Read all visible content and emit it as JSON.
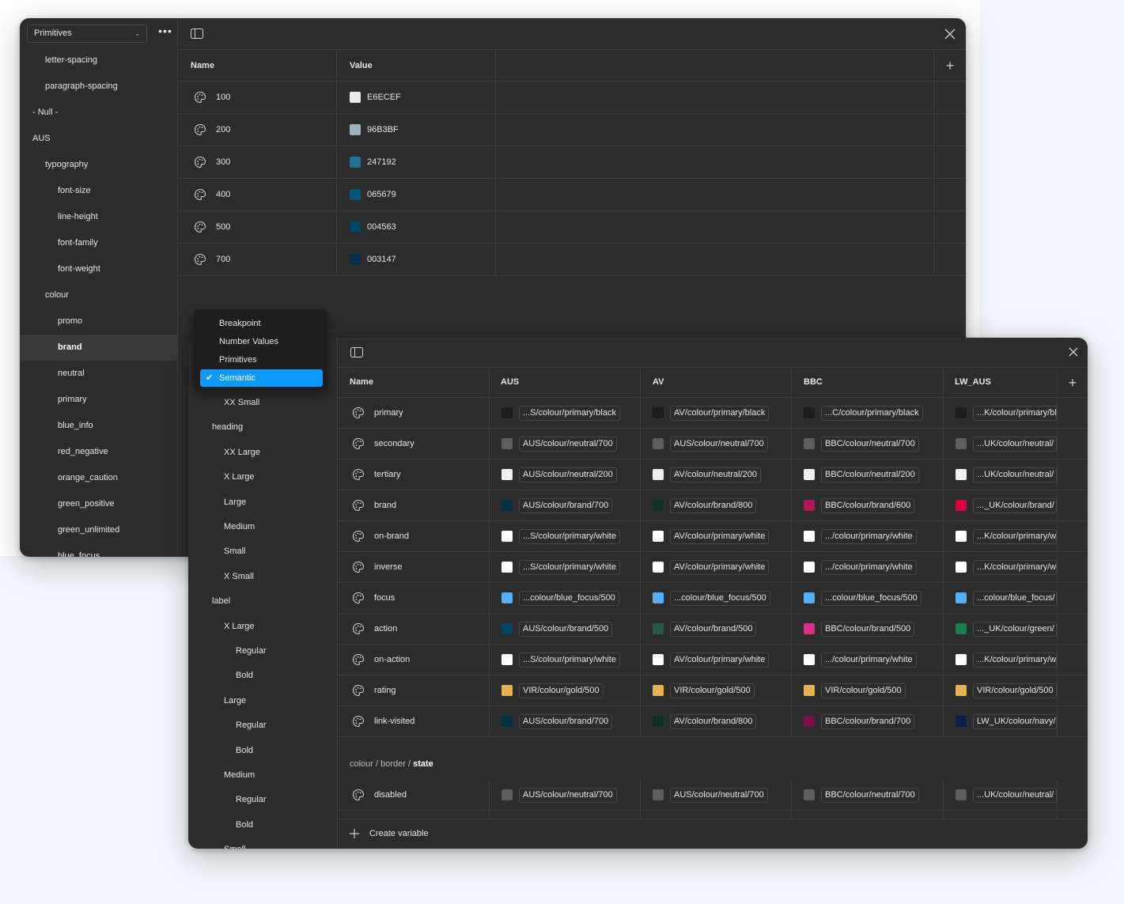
{
  "back_panel": {
    "collection_select": "Primitives",
    "sidebar": [
      {
        "label": "letter-spacing",
        "level": 1
      },
      {
        "label": "paragraph-spacing",
        "level": 1
      },
      {
        "label": "- Null -",
        "level": 0
      },
      {
        "label": "AUS",
        "level": 0
      },
      {
        "label": "typography",
        "level": 1
      },
      {
        "label": "font-size",
        "level": 2
      },
      {
        "label": "line-height",
        "level": 2
      },
      {
        "label": "font-family",
        "level": 2
      },
      {
        "label": "font-weight",
        "level": 2
      },
      {
        "label": "colour",
        "level": 1
      },
      {
        "label": "promo",
        "level": 2
      },
      {
        "label": "brand",
        "level": 2,
        "selected": true
      },
      {
        "label": "neutral",
        "level": 2
      },
      {
        "label": "primary",
        "level": 2
      },
      {
        "label": "blue_info",
        "level": 2
      },
      {
        "label": "red_negative",
        "level": 2
      },
      {
        "label": "orange_caution",
        "level": 2
      },
      {
        "label": "green_positive",
        "level": 2
      },
      {
        "label": "green_unlimited",
        "level": 2
      },
      {
        "label": "blue_focus",
        "level": 2
      }
    ],
    "columns": {
      "name": "Name",
      "value": "Value"
    },
    "rows": [
      {
        "name": "100",
        "value": "E6ECEF",
        "color": "#E6ECEF"
      },
      {
        "name": "200",
        "value": "96B3BF",
        "color": "#96B3BF"
      },
      {
        "name": "300",
        "value": "247192",
        "color": "#247192"
      },
      {
        "name": "400",
        "value": "065679",
        "color": "#065679"
      },
      {
        "name": "500",
        "value": "004563",
        "color": "#004563"
      },
      {
        "name": "700",
        "value": "003147",
        "color": "#003147"
      }
    ]
  },
  "dropdown": {
    "items": [
      {
        "label": "Breakpoint",
        "selected": false
      },
      {
        "label": "Number Values",
        "selected": false
      },
      {
        "label": "Primitives",
        "selected": false
      },
      {
        "label": "Semantic",
        "selected": true
      }
    ]
  },
  "front_panel": {
    "sidebar": [
      {
        "label": "XX Small",
        "level": 2
      },
      {
        "label": "heading",
        "level": 1
      },
      {
        "label": "XX Large",
        "level": 2
      },
      {
        "label": "X Large",
        "level": 2
      },
      {
        "label": "Large",
        "level": 2
      },
      {
        "label": "Medium",
        "level": 2
      },
      {
        "label": "Small",
        "level": 2
      },
      {
        "label": "X Small",
        "level": 2
      },
      {
        "label": "label",
        "level": 1
      },
      {
        "label": "X Large",
        "level": 2
      },
      {
        "label": "Regular",
        "level": 3
      },
      {
        "label": "Bold",
        "level": 3
      },
      {
        "label": "Large",
        "level": 2
      },
      {
        "label": "Regular",
        "level": 3
      },
      {
        "label": "Bold",
        "level": 3
      },
      {
        "label": "Medium",
        "level": 2
      },
      {
        "label": "Regular",
        "level": 3
      },
      {
        "label": "Bold",
        "level": 3
      },
      {
        "label": "Small",
        "level": 2
      }
    ],
    "columns": [
      "Name",
      "AUS",
      "AV",
      "BBC",
      "LW_AUS"
    ],
    "rows": [
      {
        "name": "primary",
        "cells": [
          {
            "text": "...S/colour/primary/black",
            "color": "#1e1e1e"
          },
          {
            "text": "AV/colour/primary/black",
            "color": "#1e1e1e"
          },
          {
            "text": "...C/colour/primary/black",
            "color": "#1e1e1e"
          },
          {
            "text": "...K/colour/primary/bl",
            "color": "#1e1e1e"
          }
        ]
      },
      {
        "name": "secondary",
        "cells": [
          {
            "text": "AUS/colour/neutral/700",
            "color": "#5e5e5e"
          },
          {
            "text": "AUS/colour/neutral/700",
            "color": "#5e5e5e"
          },
          {
            "text": "BBC/colour/neutral/700",
            "color": "#5e5e5e"
          },
          {
            "text": "...UK/colour/neutral/",
            "color": "#5e5e5e"
          }
        ]
      },
      {
        "name": "tertiary",
        "cells": [
          {
            "text": "AUS/colour/neutral/200",
            "color": "#f2f2f2"
          },
          {
            "text": "AV/colour/neutral/200",
            "color": "#f2f2f2"
          },
          {
            "text": "BBC/colour/neutral/200",
            "color": "#f2f2f2"
          },
          {
            "text": "...UK/colour/neutral/",
            "color": "#f2f2f2"
          }
        ]
      },
      {
        "name": "brand",
        "cells": [
          {
            "text": "AUS/colour/brand/700",
            "color": "#003147"
          },
          {
            "text": "AV/colour/brand/800",
            "color": "#0b3322"
          },
          {
            "text": "BBC/colour/brand/600",
            "color": "#b0185a"
          },
          {
            "text": "..._UK/colour/brand/",
            "color": "#d9003d"
          }
        ]
      },
      {
        "name": "on-brand",
        "cells": [
          {
            "text": "...S/colour/primary/white",
            "color": "#ffffff"
          },
          {
            "text": "AV/colour/primary/white",
            "color": "#ffffff"
          },
          {
            "text": ".../colour/primary/white",
            "color": "#ffffff"
          },
          {
            "text": "...K/colour/primary/w",
            "color": "#ffffff"
          }
        ]
      },
      {
        "name": "inverse",
        "cells": [
          {
            "text": "...S/colour/primary/white",
            "color": "#ffffff"
          },
          {
            "text": "AV/colour/primary/white",
            "color": "#ffffff"
          },
          {
            "text": ".../colour/primary/white",
            "color": "#ffffff"
          },
          {
            "text": "...K/colour/primary/w",
            "color": "#ffffff"
          }
        ]
      },
      {
        "name": "focus",
        "cells": [
          {
            "text": "...colour/blue_focus/500",
            "color": "#55aef5"
          },
          {
            "text": "...colour/blue_focus/500",
            "color": "#55aef5"
          },
          {
            "text": "...colour/blue_focus/500",
            "color": "#55aef5"
          },
          {
            "text": "...colour/blue_focus/",
            "color": "#55aef5"
          }
        ]
      },
      {
        "name": "action",
        "cells": [
          {
            "text": "AUS/colour/brand/500",
            "color": "#004563"
          },
          {
            "text": "AV/colour/brand/500",
            "color": "#255b45"
          },
          {
            "text": "BBC/colour/brand/500",
            "color": "#d8308a"
          },
          {
            "text": "..._UK/colour/green/",
            "color": "#14804a"
          }
        ]
      },
      {
        "name": "on-action",
        "cells": [
          {
            "text": "...S/colour/primary/white",
            "color": "#ffffff"
          },
          {
            "text": "AV/colour/primary/white",
            "color": "#ffffff"
          },
          {
            "text": ".../colour/primary/white",
            "color": "#ffffff"
          },
          {
            "text": "...K/colour/primary/w",
            "color": "#ffffff"
          }
        ]
      },
      {
        "name": "rating",
        "cells": [
          {
            "text": "VIR/colour/gold/500",
            "color": "#e6b24e"
          },
          {
            "text": "VIR/colour/gold/500",
            "color": "#e6b24e"
          },
          {
            "text": "VIR/colour/gold/500",
            "color": "#e6b24e"
          },
          {
            "text": "VIR/colour/gold/500",
            "color": "#e6b24e"
          }
        ]
      },
      {
        "name": "link-visited",
        "cells": [
          {
            "text": "AUS/colour/brand/700",
            "color": "#003147"
          },
          {
            "text": "AV/colour/brand/800",
            "color": "#0b3322"
          },
          {
            "text": "BBC/colour/brand/700",
            "color": "#7a1045"
          },
          {
            "text": "LW_UK/colour/navy/",
            "color": "#0b1f4a"
          }
        ]
      }
    ],
    "group": {
      "path": "colour / border / ",
      "current": "state"
    },
    "group_rows": [
      {
        "name": "disabled",
        "cells": [
          {
            "text": "AUS/colour/neutral/700",
            "color": "#5e5e5e"
          },
          {
            "text": "AUS/colour/neutral/700",
            "color": "#5e5e5e"
          },
          {
            "text": "BBC/colour/neutral/700",
            "color": "#5e5e5e"
          },
          {
            "text": "...UK/colour/neutral/",
            "color": "#5e5e5e"
          }
        ]
      }
    ],
    "create_variable": "Create variable"
  }
}
